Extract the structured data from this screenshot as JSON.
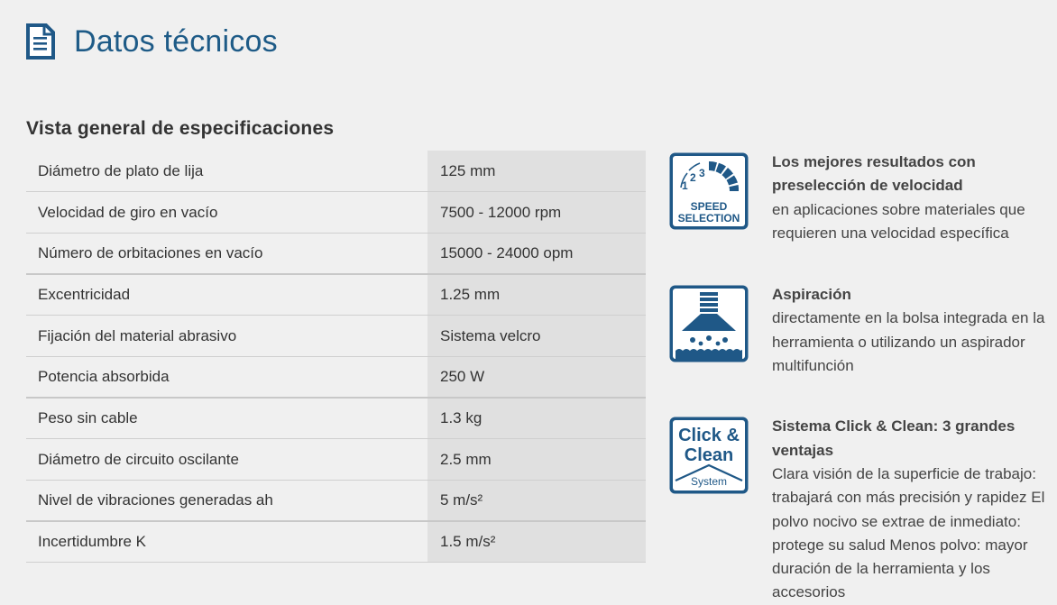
{
  "header": {
    "title": "Datos técnicos",
    "icon": "document-icon"
  },
  "specs": {
    "title": "Vista general de especificaciones",
    "rows": [
      {
        "label": "Diámetro de plato de lija",
        "value": "125 mm"
      },
      {
        "label": "Velocidad de giro en vacío",
        "value": "7500 - 12000 rpm"
      },
      {
        "label": "Número de orbitaciones en vacío",
        "value": "15000 - 24000 opm"
      },
      {
        "label": "Excentricidad",
        "value": "1.25 mm"
      },
      {
        "label": "Fijación del material abrasivo",
        "value": "Sistema velcro"
      },
      {
        "label": "Potencia absorbida",
        "value": "250 W"
      },
      {
        "label": "Peso sin cable",
        "value": "1.3 kg"
      },
      {
        "label": "Diámetro de circuito oscilante",
        "value": "2.5 mm"
      },
      {
        "label": "Nivel de vibraciones generadas ah",
        "value": "5 m/s²"
      },
      {
        "label": "Incertidumbre K",
        "value": "1.5 m/s²"
      }
    ]
  },
  "features": [
    {
      "icon": "speed-selection-icon",
      "icon_text": [
        "1",
        "2",
        "3",
        "SPEED",
        "SELECTION"
      ],
      "title": "Los mejores resultados con preselección de velocidad",
      "body": "en aplicaciones sobre materiales que requieren una velocidad específica"
    },
    {
      "icon": "dust-extraction-icon",
      "title": "Aspiración",
      "body": "directamente en la bolsa integrada en la herramienta o utilizando un aspirador multifunción"
    },
    {
      "icon": "click-clean-icon",
      "icon_text": [
        "Click &",
        "Clean",
        "System"
      ],
      "title": "Sistema Click & Clean: 3 grandes ventajas",
      "body": "Clara visión de la superficie de trabajo: trabajará con más precisión y rapidez El polvo nocivo se extrae de inmediato: protege su salud Menos polvo: mayor duración de la herramienta y los accesorios"
    }
  ],
  "colors": {
    "brand_blue": "#1e5b87",
    "icon_blue": "#1f5887"
  }
}
